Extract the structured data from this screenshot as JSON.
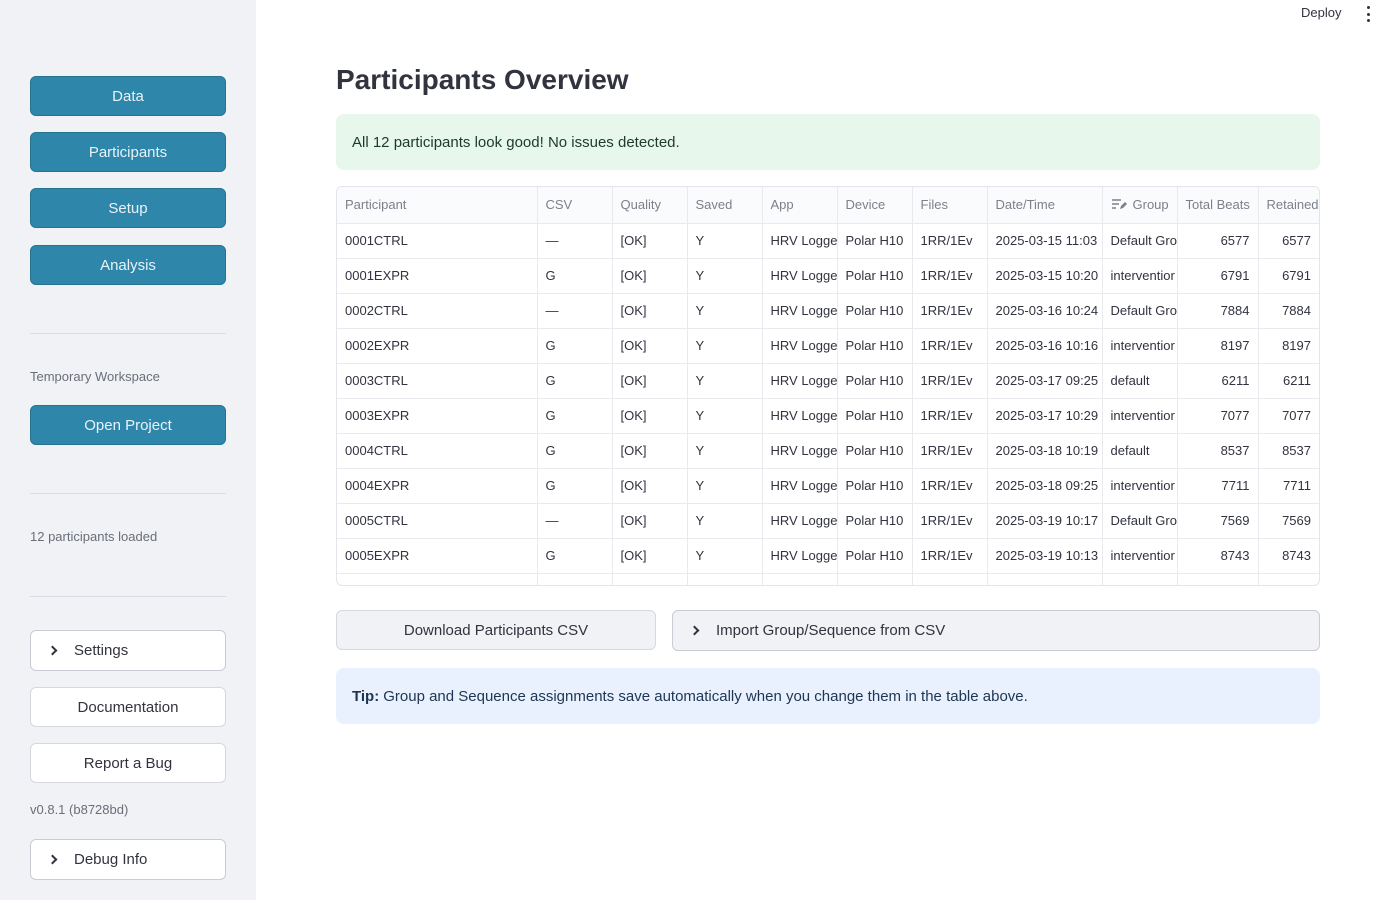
{
  "sidebar": {
    "nav": [
      "Data",
      "Participants",
      "Setup",
      "Analysis"
    ],
    "workspace_caption": "Temporary Workspace",
    "open_project": "Open Project",
    "loaded_caption": "12 participants loaded",
    "settings": "Settings",
    "documentation": "Documentation",
    "report_bug": "Report a Bug",
    "version": "v0.8.1 (b8728bd)",
    "debug_info": "Debug Info"
  },
  "header": {
    "deploy": "Deploy",
    "menu_icon": "kebab-menu-icon"
  },
  "main": {
    "title": "Participants Overview",
    "success_message": "All 12 participants look good! No issues detected.",
    "table": {
      "columns": [
        "Participant",
        "CSV",
        "Quality",
        "Saved",
        "App",
        "Device",
        "Files",
        "Date/Time",
        "Group",
        "Total Beats",
        "Retained"
      ],
      "rows": [
        [
          "0001CTRL",
          "—",
          "[OK]",
          "Y",
          "HRV Logger",
          "Polar H10",
          "1RR/1Ev",
          "2025-03-15 11:03",
          "Default Gro",
          "6577",
          "6577"
        ],
        [
          "0001EXPR",
          "G",
          "[OK]",
          "Y",
          "HRV Logger",
          "Polar H10",
          "1RR/1Ev",
          "2025-03-15 10:20",
          "interventior",
          "6791",
          "6791"
        ],
        [
          "0002CTRL",
          "—",
          "[OK]",
          "Y",
          "HRV Logger",
          "Polar H10",
          "1RR/1Ev",
          "2025-03-16 10:24",
          "Default Gro",
          "7884",
          "7884"
        ],
        [
          "0002EXPR",
          "G",
          "[OK]",
          "Y",
          "HRV Logger",
          "Polar H10",
          "1RR/1Ev",
          "2025-03-16 10:16",
          "interventior",
          "8197",
          "8197"
        ],
        [
          "0003CTRL",
          "G",
          "[OK]",
          "Y",
          "HRV Logger",
          "Polar H10",
          "1RR/1Ev",
          "2025-03-17 09:25",
          "default",
          "6211",
          "6211"
        ],
        [
          "0003EXPR",
          "G",
          "[OK]",
          "Y",
          "HRV Logger",
          "Polar H10",
          "1RR/1Ev",
          "2025-03-17 10:29",
          "interventior",
          "7077",
          "7077"
        ],
        [
          "0004CTRL",
          "G",
          "[OK]",
          "Y",
          "HRV Logger",
          "Polar H10",
          "1RR/1Ev",
          "2025-03-18 10:19",
          "default",
          "8537",
          "8537"
        ],
        [
          "0004EXPR",
          "G",
          "[OK]",
          "Y",
          "HRV Logger",
          "Polar H10",
          "1RR/1Ev",
          "2025-03-18 09:25",
          "interventior",
          "7711",
          "7711"
        ],
        [
          "0005CTRL",
          "—",
          "[OK]",
          "Y",
          "HRV Logger",
          "Polar H10",
          "1RR/1Ev",
          "2025-03-19 10:17",
          "Default Gro",
          "7569",
          "7569"
        ],
        [
          "0005EXPR",
          "G",
          "[OK]",
          "Y",
          "HRV Logger",
          "Polar H10",
          "1RR/1Ev",
          "2025-03-19 10:13",
          "interventior",
          "8743",
          "8743"
        ]
      ]
    },
    "download_button": "Download Participants CSV",
    "import_expander": "Import Group/Sequence from CSV",
    "tip_label": "Tip:",
    "tip_text": "Group and Sequence assignments save automatically when you change them in the table above."
  }
}
